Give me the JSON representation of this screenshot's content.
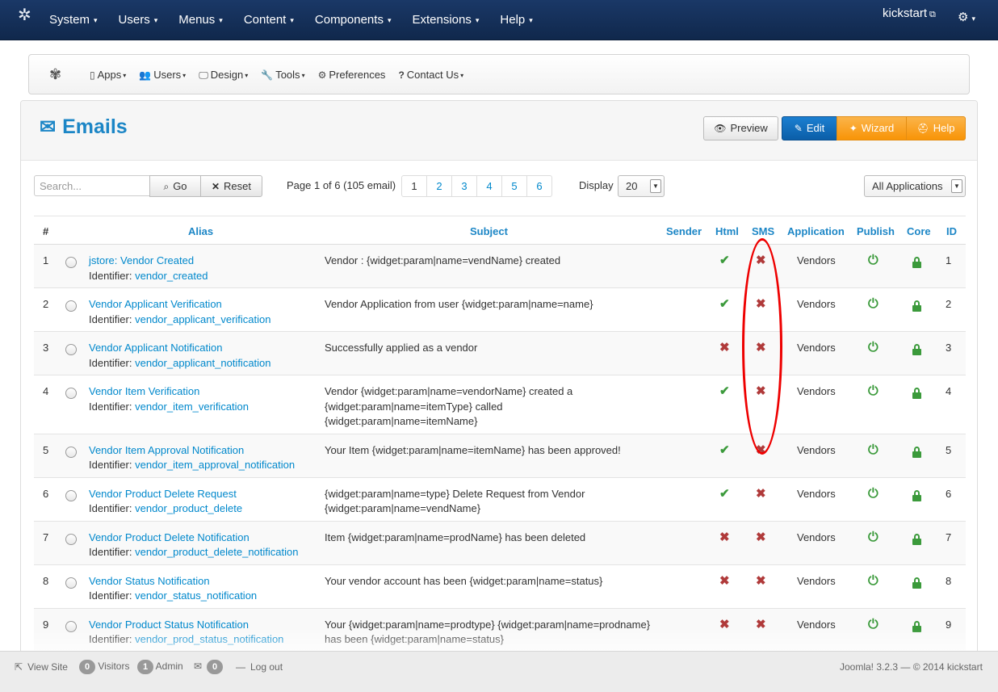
{
  "topbar": {
    "logo": "joomla-logo",
    "menu": [
      "System",
      "Users",
      "Menus",
      "Content",
      "Components",
      "Extensions",
      "Help"
    ],
    "user": "kickstart"
  },
  "subnav": {
    "items": [
      {
        "label": "Apps",
        "icon": "phone-icon"
      },
      {
        "label": "Users",
        "icon": "users-icon"
      },
      {
        "label": "Design",
        "icon": "monitor-icon"
      },
      {
        "label": "Tools",
        "icon": "wrench-icon"
      },
      {
        "label": "Preferences",
        "icon": "cogs-icon"
      },
      {
        "label": "Contact Us",
        "icon": "question-icon"
      }
    ]
  },
  "header": {
    "title": "Emails",
    "buttons": {
      "preview": "Preview",
      "edit": "Edit",
      "wizard": "Wizard",
      "help": "Help"
    }
  },
  "toolbar": {
    "search_placeholder": "Search...",
    "go_label": "Go",
    "reset_label": "Reset",
    "page_info": "Page 1 of 6 (105 email)",
    "pages": [
      "1",
      "2",
      "3",
      "4",
      "5",
      "6"
    ],
    "display_label": "Display",
    "display_value": "20",
    "app_filter": "All Applications"
  },
  "table": {
    "columns": {
      "num": "#",
      "alias": "Alias",
      "subject": "Subject",
      "sender": "Sender",
      "html": "Html",
      "sms": "SMS",
      "application": "Application",
      "publish": "Publish",
      "core": "Core",
      "id": "ID"
    },
    "identifier_label": "Identifier:",
    "rows": [
      {
        "num": "1",
        "alias": "jstore: Vendor Created",
        "identifier": "vendor_created",
        "subject": [
          "Vendor : {widget:param|name=vendName} created"
        ],
        "html": true,
        "sms": false,
        "application": "Vendors",
        "id": "1"
      },
      {
        "num": "2",
        "alias": "Vendor Applicant Verification",
        "identifier": "vendor_applicant_verification",
        "subject": [
          "Vendor Application from user {widget:param|name=name}"
        ],
        "html": true,
        "sms": false,
        "application": "Vendors",
        "id": "2"
      },
      {
        "num": "3",
        "alias": "Vendor Applicant Notification",
        "identifier": "vendor_applicant_notification",
        "subject": [
          "Successfully applied as a vendor"
        ],
        "html": false,
        "sms": false,
        "application": "Vendors",
        "id": "3"
      },
      {
        "num": "4",
        "alias": "Vendor Item Verification",
        "identifier": "vendor_item_verification",
        "subject": [
          "Vendor {widget:param|name=vendorName} created a",
          "{widget:param|name=itemType} called",
          "{widget:param|name=itemName}"
        ],
        "html": true,
        "sms": false,
        "application": "Vendors",
        "id": "4"
      },
      {
        "num": "5",
        "alias": "Vendor Item Approval Notification",
        "identifier": "vendor_item_approval_notification",
        "subject": [
          "Your Item {widget:param|name=itemName} has been approved!"
        ],
        "html": true,
        "sms": false,
        "application": "Vendors",
        "id": "5"
      },
      {
        "num": "6",
        "alias": "Vendor Product Delete Request",
        "identifier": "vendor_product_delete",
        "subject": [
          "{widget:param|name=type} Delete Request from Vendor",
          "{widget:param|name=vendName}"
        ],
        "html": true,
        "sms": false,
        "application": "Vendors",
        "id": "6"
      },
      {
        "num": "7",
        "alias": "Vendor Product Delete Notification",
        "identifier": "vendor_product_delete_notification",
        "subject": [
          "Item {widget:param|name=prodName} has been deleted"
        ],
        "html": false,
        "sms": false,
        "application": "Vendors",
        "id": "7"
      },
      {
        "num": "8",
        "alias": "Vendor Status Notification",
        "identifier": "vendor_status_notification",
        "subject": [
          "Your vendor account has been {widget:param|name=status}"
        ],
        "html": false,
        "sms": false,
        "application": "Vendors",
        "id": "8"
      },
      {
        "num": "9",
        "alias": "Vendor Product Status Notification",
        "identifier": "vendor_prod_status_notification",
        "subject": [
          "Your {widget:param|name=prodtype} {widget:param|name=prodname}",
          "has been {widget:param|name=status}"
        ],
        "html": false,
        "sms": false,
        "application": "Vendors",
        "id": "9"
      }
    ]
  },
  "statusbar": {
    "view_site": "View Site",
    "visitors_count": "0",
    "visitors_label": "Visitors",
    "admin_count": "1",
    "admin_label": "Admin",
    "messages_count": "0",
    "logout": "Log out",
    "version": "Joomla! 3.2.3  —  © 2014 kickstart"
  },
  "colors": {
    "brand_blue": "#1c86c6",
    "navbar": "#10284c",
    "ok_green": "#3b9a3b",
    "no_red": "#b03a3a",
    "annotation": "#e00000"
  }
}
